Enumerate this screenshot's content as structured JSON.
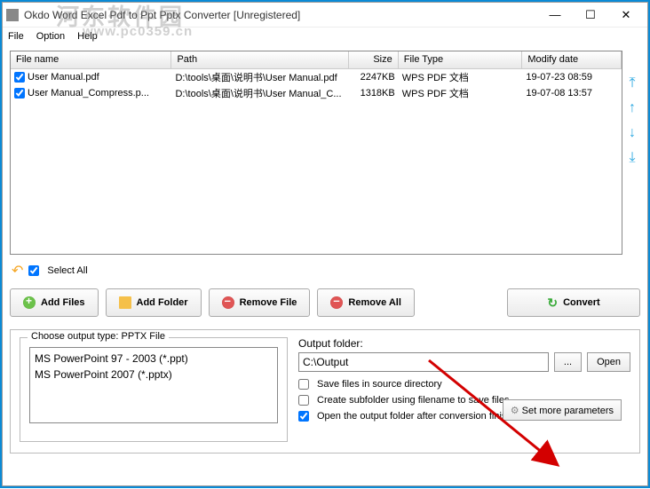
{
  "window": {
    "title": "Okdo Word Excel Pdf to Ppt Pptx Converter [Unregistered]",
    "min_label": "—",
    "max_label": "☐",
    "close_label": "✕"
  },
  "menu": {
    "file": "File",
    "option": "Option",
    "help": "Help"
  },
  "watermark": {
    "line1": "河东软件园",
    "line2": "www.pc0359.cn"
  },
  "columns": {
    "fname": "File name",
    "path": "Path",
    "size": "Size",
    "type": "File Type",
    "date": "Modify date"
  },
  "files": [
    {
      "checked": true,
      "name": "User Manual.pdf",
      "path": "D:\\tools\\桌面\\说明书\\User Manual.pdf",
      "size": "2247KB",
      "type": "WPS PDF 文档",
      "date": "19-07-23 08:59"
    },
    {
      "checked": true,
      "name": "User Manual_Compress.p...",
      "path": "D:\\tools\\桌面\\说明书\\User Manual_C...",
      "size": "1318KB",
      "type": "WPS PDF 文档",
      "date": "19-07-08 13:57"
    }
  ],
  "select_all": "Select All",
  "buttons": {
    "add_files": "Add Files",
    "add_folder": "Add Folder",
    "remove_file": "Remove File",
    "remove_all": "Remove All",
    "convert": "Convert"
  },
  "output_type": {
    "legend": "Choose output type:  PPTX File",
    "opts": [
      "MS PowerPoint 97 - 2003 (*.ppt)",
      "MS PowerPoint 2007 (*.pptx)"
    ]
  },
  "output_folder": {
    "label": "Output folder:",
    "value": "C:\\Output",
    "browse": "...",
    "open": "Open"
  },
  "options": {
    "save_in_source": "Save files in source directory",
    "create_subfolder": "Create subfolder using filename to save files",
    "open_after": "Open the output folder after conversion finished"
  },
  "set_more": "Set more parameters",
  "side_icons": {
    "top": "⤒",
    "up": "↑",
    "down": "↓",
    "bottom": "⤓"
  }
}
